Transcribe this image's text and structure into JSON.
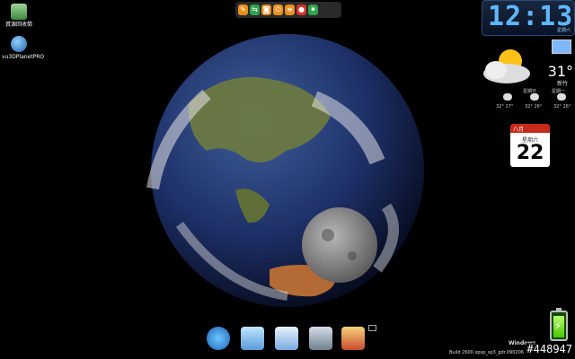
{
  "desktop": {
    "icons": [
      {
        "label": "資源回收筒",
        "icon": "recycle-bin-icon"
      },
      {
        "label": "vu3DPlanetPRO",
        "icon": "globe-app-icon"
      }
    ]
  },
  "toolbar": {
    "buttons": [
      {
        "name": "wrench-icon",
        "color": "#e98f1e"
      },
      {
        "name": "swap-arrows-icon",
        "color": "#2ea34f"
      },
      {
        "name": "lock-icon",
        "color": "#e98f1e"
      },
      {
        "name": "power-icon",
        "color": "#e98f1e"
      },
      {
        "name": "lines-icon",
        "color": "#e98f1e"
      },
      {
        "name": "stop-icon",
        "color": "#d8322a"
      },
      {
        "name": "sun-icon",
        "color": "#2ea34f"
      }
    ]
  },
  "clock": {
    "time": "12:13",
    "sub": "星期六"
  },
  "weather": {
    "temp": "31°",
    "city": "新竹",
    "forecast_days": [
      "星期日",
      "星期一"
    ],
    "forecast_temps": [
      "32° 27°",
      "32° 26°",
      "32° 26°"
    ]
  },
  "calendar": {
    "month": "八月",
    "weekday": "星期六",
    "day": "22"
  },
  "dock": {
    "items": [
      {
        "name": "internet-explorer-icon"
      },
      {
        "name": "my-computer-icon"
      },
      {
        "name": "notepad-icon"
      },
      {
        "name": "calculator-icon"
      },
      {
        "name": "paint-icon"
      }
    ]
  },
  "status": {
    "watermark": "Windows",
    "build": "Build 2600.xpsp_sp3_gdr.090206",
    "number": "#448947"
  },
  "colors": {
    "background": "#000000",
    "clock_digits": "#5fb7ff",
    "battery": "#4bc600",
    "calendar_header": "#c62a1c"
  }
}
